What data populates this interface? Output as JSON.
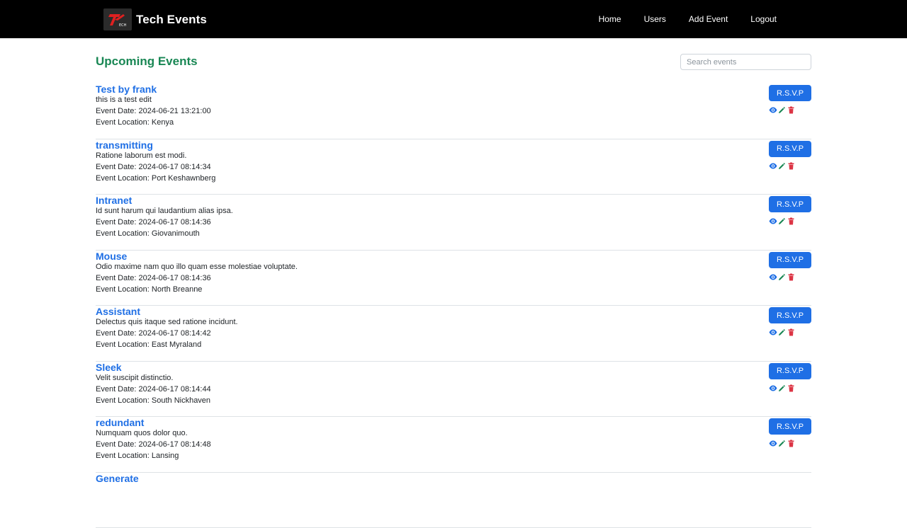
{
  "navbar": {
    "brand": "Tech Events",
    "links": [
      "Home",
      "Users",
      "Add Event",
      "Logout"
    ]
  },
  "page": {
    "title": "Upcoming Events",
    "search_placeholder": "Search events"
  },
  "events": [
    {
      "title": "Test by frank",
      "description": "this is a test edit",
      "date": "Event Date: 2024-06-21 13:21:00",
      "location": "Event Location: Kenya",
      "rsvp": "R.S.V.P"
    },
    {
      "title": "transmitting",
      "description": "Ratione laborum est modi.",
      "date": "Event Date: 2024-06-17 08:14:34",
      "location": "Event Location: Port Keshawnberg",
      "rsvp": "R.S.V.P"
    },
    {
      "title": "Intranet",
      "description": "Id sunt harum qui laudantium alias ipsa.",
      "date": "Event Date: 2024-06-17 08:14:36",
      "location": "Event Location: Giovanimouth",
      "rsvp": "R.S.V.P"
    },
    {
      "title": "Mouse",
      "description": "Odio maxime nam quo illo quam esse molestiae voluptate.",
      "date": "Event Date: 2024-06-17 08:14:36",
      "location": "Event Location: North Breanne",
      "rsvp": "R.S.V.P"
    },
    {
      "title": "Assistant",
      "description": "Delectus quis itaque sed ratione incidunt.",
      "date": "Event Date: 2024-06-17 08:14:42",
      "location": "Event Location: East Myraland",
      "rsvp": "R.S.V.P"
    },
    {
      "title": "Sleek",
      "description": "Velit suscipit distinctio.",
      "date": "Event Date: 2024-06-17 08:14:44",
      "location": "Event Location: South Nickhaven",
      "rsvp": "R.S.V.P"
    },
    {
      "title": "redundant",
      "description": "Numquam quos dolor quo.",
      "date": "Event Date: 2024-06-17 08:14:48",
      "location": "Event Location: Lansing",
      "rsvp": "R.S.V.P"
    },
    {
      "title": "Generate",
      "description": "",
      "date": "",
      "location": "",
      "rsvp": ""
    }
  ],
  "colors": {
    "accent": "#1f6fe5",
    "title_green": "#198754",
    "edit": "#198754",
    "delete": "#dc3545"
  },
  "icons": {
    "view": "eye-icon",
    "edit": "pencil-icon",
    "delete": "trash-icon"
  }
}
